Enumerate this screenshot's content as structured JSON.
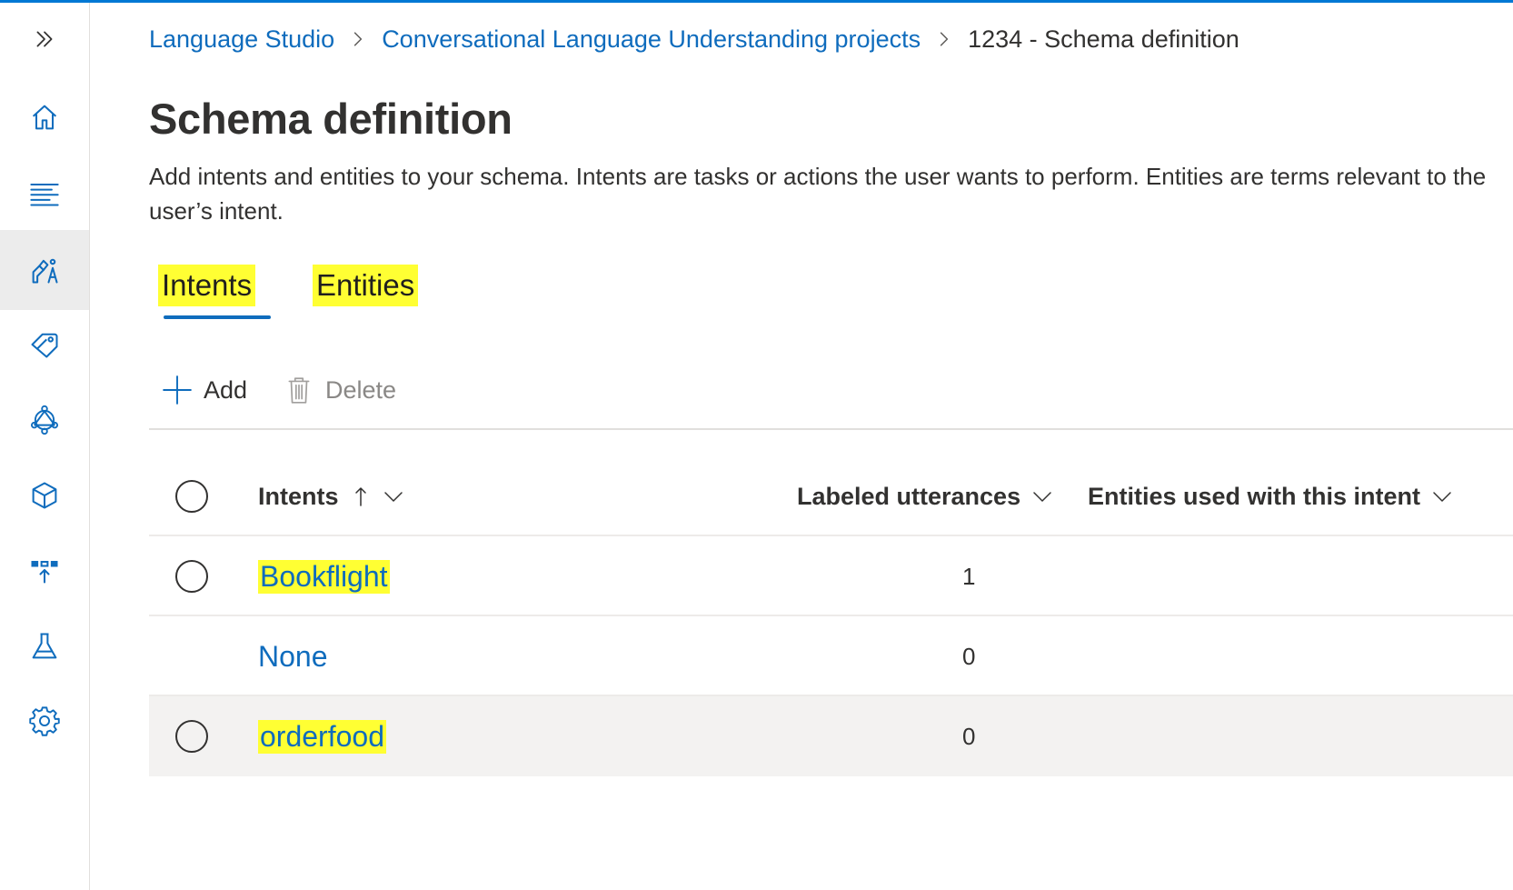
{
  "colors": {
    "accent": "#0078d4",
    "link": "#0f6cbd",
    "highlight": "#ffff33",
    "selected_row": "#f3f2f1"
  },
  "sidebar": {
    "items": [
      {
        "name": "expand",
        "icon": "double-chevron-right-icon"
      },
      {
        "name": "home",
        "icon": "home-icon"
      },
      {
        "name": "text-list",
        "icon": "text-lines-icon"
      },
      {
        "name": "schema",
        "icon": "build-tools-icon",
        "selected": true
      },
      {
        "name": "labeling",
        "icon": "tag-icon"
      },
      {
        "name": "training",
        "icon": "network-icon"
      },
      {
        "name": "models",
        "icon": "cube-icon"
      },
      {
        "name": "deploy",
        "icon": "deploy-icon"
      },
      {
        "name": "test",
        "icon": "flask-icon"
      },
      {
        "name": "settings",
        "icon": "gear-icon"
      }
    ]
  },
  "breadcrumb": {
    "items": [
      {
        "label": "Language Studio"
      },
      {
        "label": "Conversational Language Understanding projects"
      },
      {
        "label": "1234 - Schema definition"
      }
    ]
  },
  "page": {
    "title": "Schema definition",
    "description": "Add intents and entities to your schema. Intents are tasks or actions the user wants to perform. Entities are terms relevant to the user’s intent."
  },
  "tabs": [
    {
      "label": "Intents",
      "active": true
    },
    {
      "label": "Entities",
      "active": false
    }
  ],
  "commands": {
    "add_label": "Add",
    "delete_label": "Delete"
  },
  "table": {
    "columns": {
      "intents": "Intents",
      "labeled": "Labeled utterances",
      "entities": "Entities used with this intent"
    },
    "rows": [
      {
        "intent": "Bookflight",
        "labeled": "1",
        "entities": "",
        "has_radio": true
      },
      {
        "intent": "None",
        "labeled": "0",
        "entities": "",
        "has_radio": false
      },
      {
        "intent": "orderfood",
        "labeled": "0",
        "entities": "",
        "has_radio": true
      }
    ]
  }
}
